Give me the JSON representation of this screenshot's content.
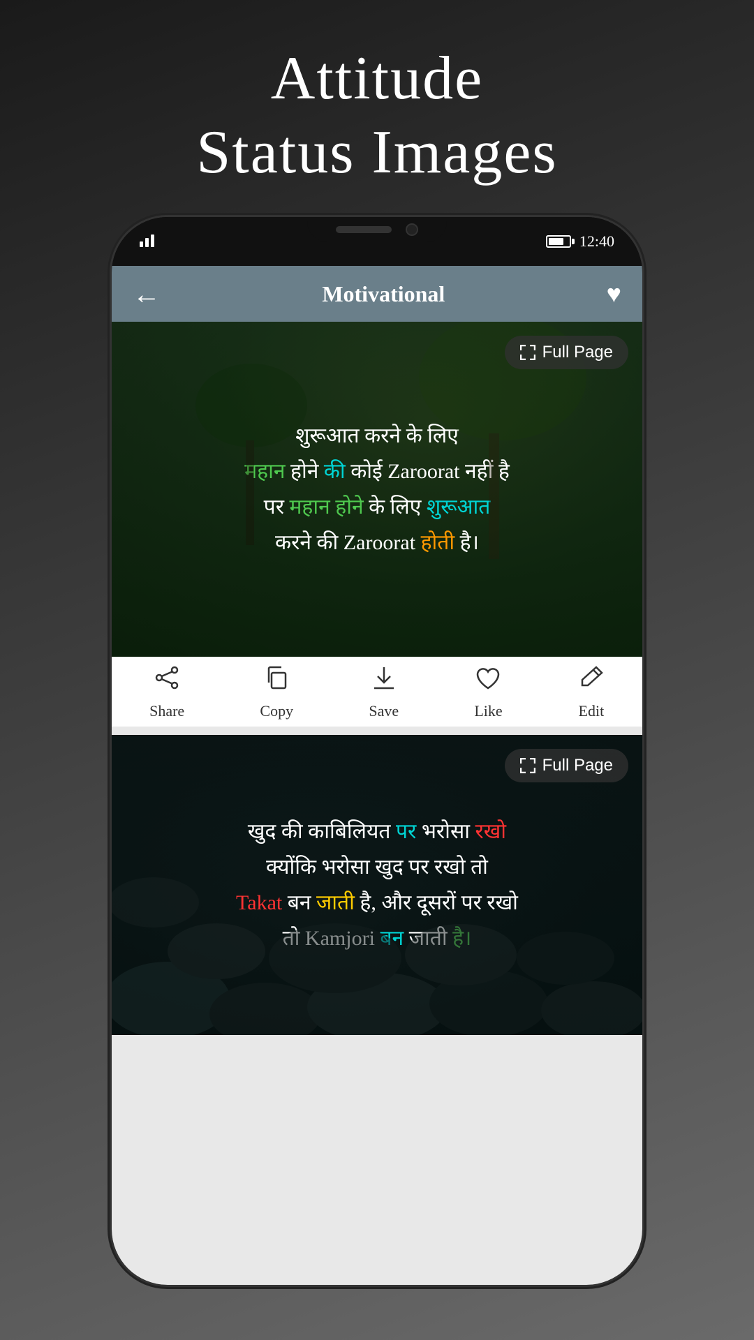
{
  "page": {
    "title_line1": "Attitude",
    "title_line2": "Status Images"
  },
  "status_bar": {
    "time": "12:40"
  },
  "app_bar": {
    "title": "Motivational",
    "back_label": "←",
    "heart_label": "♥"
  },
  "card1": {
    "full_page_label": "Full Page",
    "quote_html": "शुरूआत करने के लिए\nमहान होने की कोई Zaroorat नहीं है\nपर महान होने के लिए शुरूआत\nकरने की Zaroorat होती है।",
    "actions": [
      {
        "id": "share",
        "icon": "share",
        "label": "Share"
      },
      {
        "id": "copy",
        "icon": "copy",
        "label": "Copy"
      },
      {
        "id": "save",
        "icon": "save",
        "label": "Save"
      },
      {
        "id": "like",
        "icon": "like",
        "label": "Like"
      },
      {
        "id": "edit",
        "icon": "edit",
        "label": "Edit"
      }
    ]
  },
  "card2": {
    "full_page_label": "Full Page",
    "quote_html": "खुद की काबिलियत पर भरोसा रखो\nक्योंकि भरोसा खुद पर रखो तो\nTakat बन जाती है, और दूसरों पर रखो\nतो Kamjori बन जाती है।"
  }
}
